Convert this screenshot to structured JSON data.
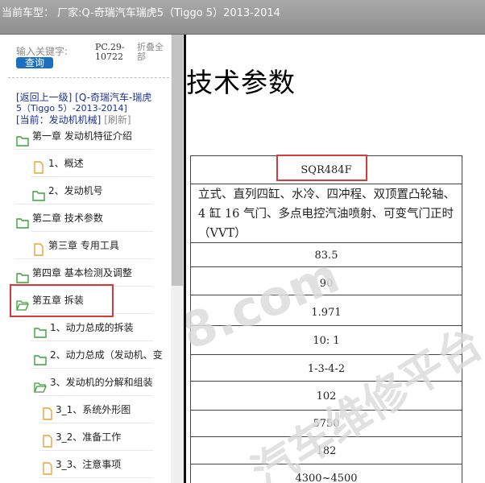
{
  "titlebar": {
    "title": "当前车型： 厂家:Q-奇瑞汽车瑞虎5（Tiggo 5）2013-2014"
  },
  "search": {
    "label": "输入关键字:",
    "code_line1": "PC.29-",
    "code_line2": "10722",
    "collapse_line1": "折叠全",
    "collapse_line2": "部",
    "button_label": "查询"
  },
  "nav": {
    "back_part1": "[返回上一级]  [Q-奇瑞汽车-瑞虎",
    "back_part2": "5（Tiggo 5）-2013-2014]",
    "current_label": "[当前：发动机机械]",
    "refresh_label": "[刷新]"
  },
  "tree": [
    {
      "label": "第一章 发动机特征介绍",
      "icon": "folder-icon"
    },
    {
      "label": "1、概述",
      "icon": "document-icon"
    },
    {
      "label": "2、发动机号",
      "icon": "folder-icon"
    },
    {
      "label": "第二章 技术参数",
      "icon": "folder-icon"
    },
    {
      "label": "第三章 专用工具",
      "icon": "document-icon"
    },
    {
      "label": "第四章 基本检测及调整",
      "icon": "folder-icon"
    },
    {
      "label": "第五章 拆装",
      "icon": "folder-icon"
    },
    {
      "label": "1、动力总成的拆装",
      "icon": "folder-icon"
    },
    {
      "label": "2、动力总成（发动机、变",
      "icon": "folder-icon"
    },
    {
      "label": "3、发动机的分解和组装",
      "icon": "folder-icon"
    },
    {
      "label": "3_1、系统外形图",
      "icon": "document-icon"
    },
    {
      "label": "3_2、准备工作",
      "icon": "document-icon"
    },
    {
      "label": "3_3、注意事项",
      "icon": "document-icon"
    }
  ],
  "document": {
    "title": "技术参数",
    "model": "SQR484F",
    "description": "立式、直列四缸、水冷、四冲程、双顶置凸轮轴、4 缸 16 气门、多点电控汽油喷射、可变气门正时（VVT）",
    "values": [
      "83.5",
      "90",
      "1.971",
      "10: 1",
      "1-3-4-2",
      "102",
      "5750",
      "182",
      "4300~4500"
    ]
  },
  "watermark": {
    "text1": "8.com",
    "text2": "汽车维修平台"
  },
  "colors": {
    "titlebar": "#9a9a9a",
    "link": "#1a2f9a",
    "button": "#1c6fc0",
    "highlight": "#d83a3a",
    "folder": "#3aa13a",
    "document": "#e8a13a"
  }
}
